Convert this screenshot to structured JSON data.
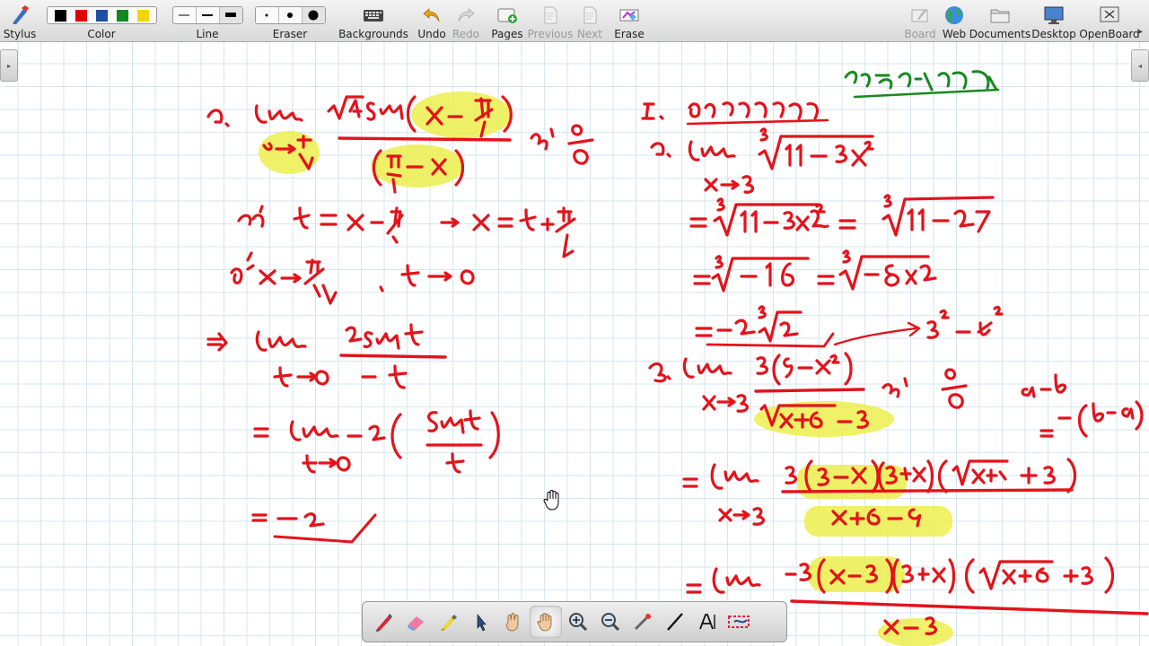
{
  "toolbar": {
    "stylus": "Stylus",
    "color": "Color",
    "line": "Line",
    "eraser": "Eraser",
    "backgrounds": "Backgrounds",
    "undo": "Undo",
    "redo": "Redo",
    "pages": "Pages",
    "previous": "Previous",
    "next": "Next",
    "erase": "Erase",
    "board": "Board",
    "web": "Web",
    "documents": "Documents",
    "desktop": "Desktop",
    "openboard": "OpenBoard"
  },
  "colors": {
    "swatches": [
      "#000000",
      "#e00000",
      "#1f4fa0",
      "#0e8a1e",
      "#f2d40c"
    ],
    "ink_red": "#e3131b",
    "ink_green": "#178a1f",
    "highlighter": "#ecef4d",
    "grid": "#d6e6f1"
  },
  "dock": {
    "tools": [
      "pen-icon",
      "eraser-icon",
      "marker-icon",
      "selector-icon",
      "play-icon",
      "hand-icon",
      "zoom-in-icon",
      "zoom-out-icon",
      "laser-pointer-icon",
      "line-icon",
      "text-icon",
      "capture-icon"
    ]
  }
}
